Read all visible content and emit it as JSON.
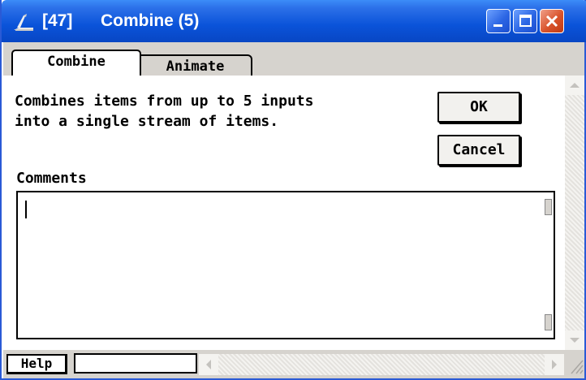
{
  "window": {
    "title_id": "[47]",
    "title_name": "Combine (5)"
  },
  "tabs": [
    {
      "label": "Combine",
      "active": true
    },
    {
      "label": "Animate",
      "active": false
    }
  ],
  "description": {
    "line1": "Combines items from up to 5 inputs",
    "line2": "into a single stream of items."
  },
  "buttons": {
    "ok": "OK",
    "cancel": "Cancel",
    "help": "Help"
  },
  "comments": {
    "label": "Comments",
    "value": ""
  },
  "status_field": {
    "value": ""
  },
  "colors": {
    "titlebar": "#0a53d9",
    "close_button": "#d9532b",
    "chrome": "#d6d3ce"
  },
  "icons": [
    "app-icon",
    "minimize-icon",
    "maximize-icon",
    "close-icon",
    "scroll-up-arrow-icon",
    "scroll-down-arrow-icon",
    "scroll-left-arrow-icon",
    "scroll-right-arrow-icon",
    "resize-grip-icon"
  ]
}
